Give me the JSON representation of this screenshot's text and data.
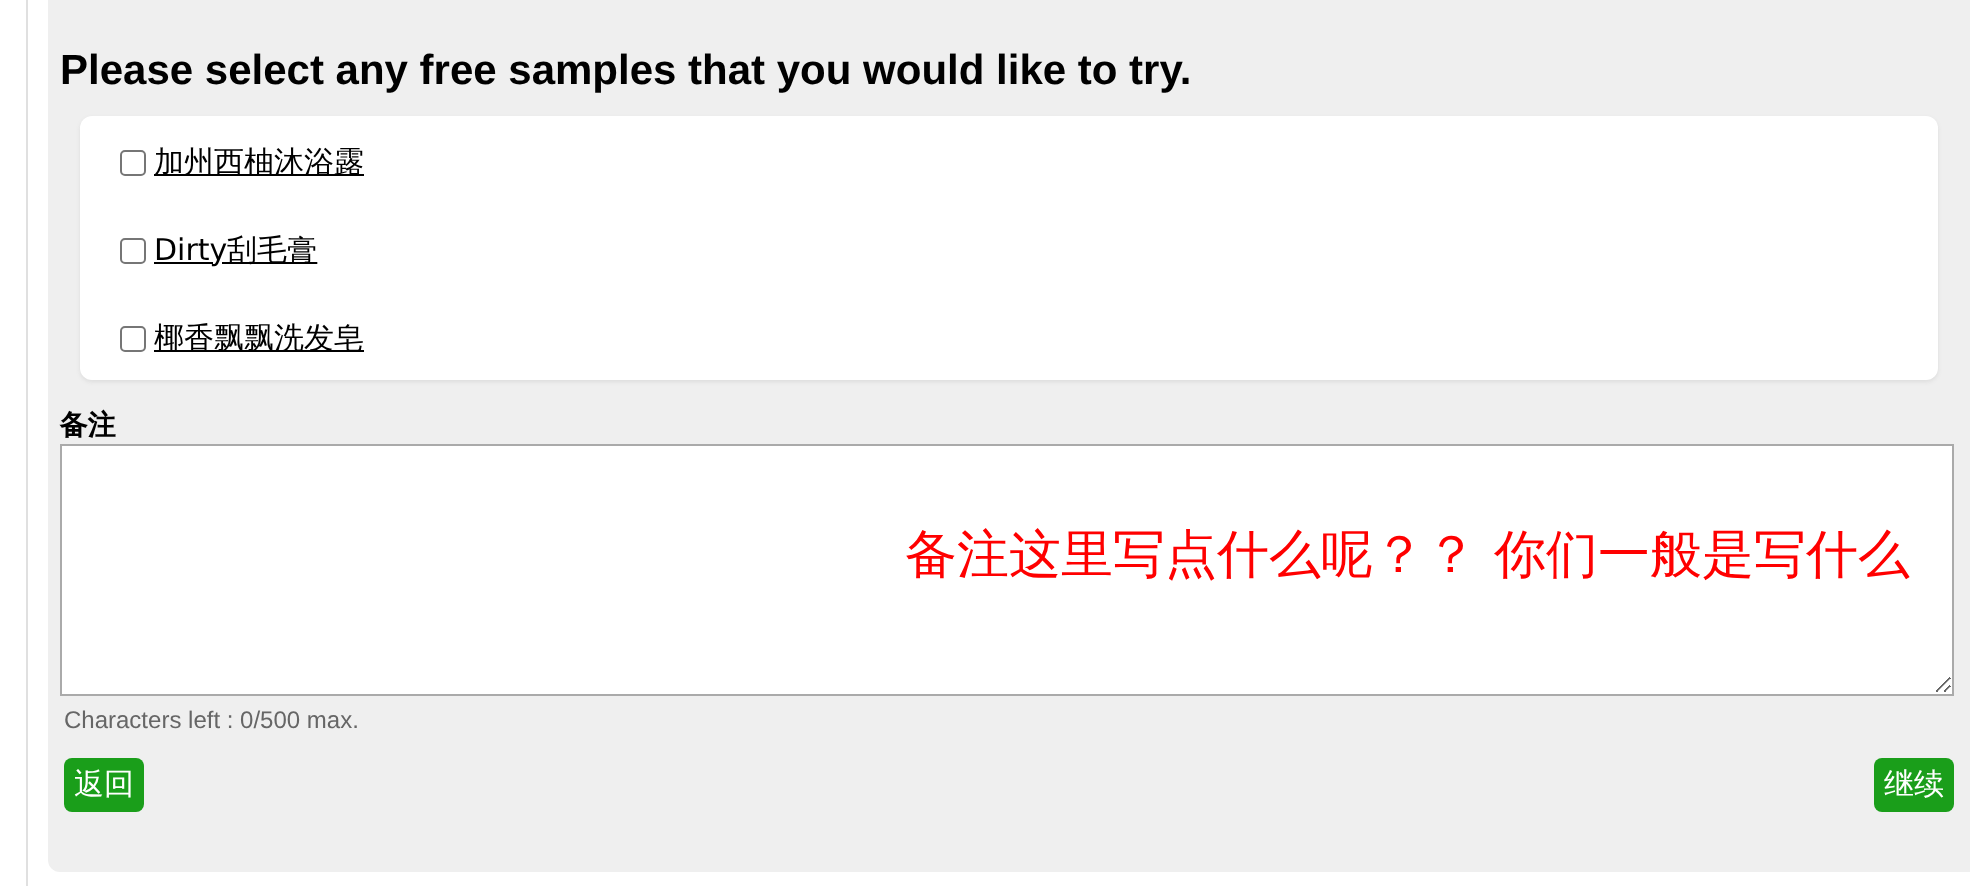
{
  "heading": "Please select any free samples that you would like to try.",
  "samples": [
    {
      "label": "加州西柚沐浴露",
      "checked": false
    },
    {
      "label": "Dirty刮毛膏",
      "checked": false
    },
    {
      "label": "椰香飘飘洗发皂",
      "checked": false
    }
  ],
  "notes": {
    "label": "备注",
    "annotation": "备注这里写点什么呢？？ 你们一般是写什么",
    "counter": "Characters left : 0/500 max."
  },
  "buttons": {
    "back": "返回",
    "continue": "继续"
  }
}
